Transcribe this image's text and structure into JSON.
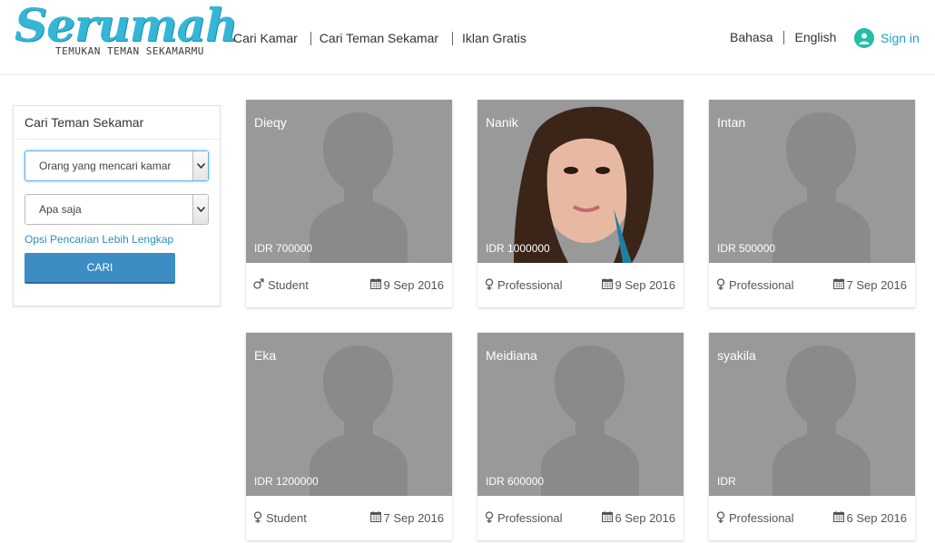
{
  "header": {
    "logo_title": "Serumah",
    "logo_tagline": "TEMUKAN TEMAN SEKAMARMU",
    "nav": [
      "Cari Kamar",
      "Cari Teman Sekamar",
      "Iklan Gratis"
    ],
    "lang_label": "Bahasa",
    "lang_value": "English",
    "signin": "Sign in"
  },
  "sidebar": {
    "title": "Cari Teman Sekamar",
    "select_type": "Orang yang mencari kamar",
    "select_any": "Apa saja",
    "more_options": "Opsi Pencarian Lebih Lengkap",
    "search_button": "CARI"
  },
  "cards": [
    {
      "name": "Dieqy",
      "price": "IDR 700000",
      "gender": "male",
      "job": "Student",
      "date": "9 Sep 2016"
    },
    {
      "name": "Nanik",
      "price": "IDR 1000000",
      "gender": "female",
      "job": "Professional",
      "date": "9 Sep 2016"
    },
    {
      "name": "Intan",
      "price": "IDR 500000",
      "gender": "female",
      "job": "Professional",
      "date": "7 Sep 2016"
    },
    {
      "name": "Eka",
      "price": "IDR 1200000",
      "gender": "female",
      "job": "Student",
      "date": "7 Sep 2016"
    },
    {
      "name": "Meidiana",
      "price": "IDR 600000",
      "gender": "female",
      "job": "Professional",
      "date": "6 Sep 2016"
    },
    {
      "name": "syakila",
      "price": "IDR",
      "gender": "female",
      "job": "Professional",
      "date": "6 Sep 2016"
    }
  ],
  "colors": {
    "accent": "#35b6d6",
    "link": "#1da1c6",
    "button": "#3b8dc4",
    "placeholder": "#999999"
  },
  "icons": {
    "signin": "user-icon",
    "male": "male-icon",
    "female": "female-icon",
    "date": "calendar-icon"
  }
}
